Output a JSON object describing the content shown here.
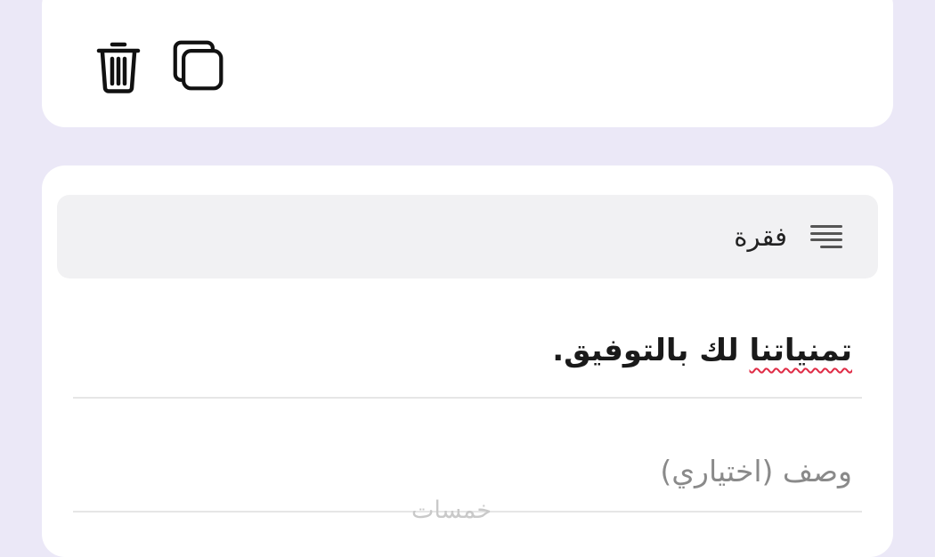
{
  "top_card": {
    "actions": [
      {
        "name": "delete-button",
        "icon": "trash-icon"
      },
      {
        "name": "duplicate-button",
        "icon": "copy-icon"
      }
    ]
  },
  "question": {
    "type_label": "فقرة",
    "type_icon": "paragraph-lines-icon",
    "content_spellchecked": "تمنياتنا",
    "content_rest": " لك بالتوفيق.",
    "description_placeholder": "وصف (اختياري)"
  },
  "watermark": "خمسات",
  "colors": {
    "background": "#ebe8f7",
    "card": "#ffffff",
    "type_bar": "#f1f1f3",
    "spellcheck_underline": "#e02b45"
  }
}
